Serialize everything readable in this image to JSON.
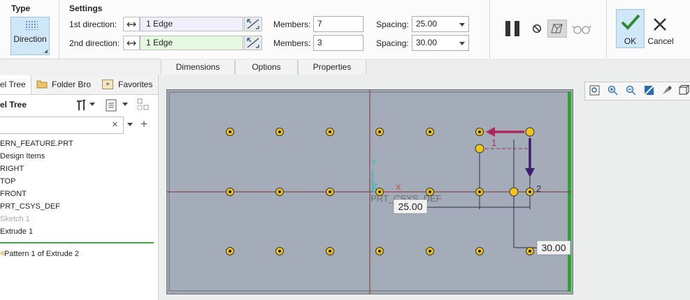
{
  "ribbon": {
    "type_group": {
      "title": "Type",
      "direction_label": "Direction"
    },
    "settings": {
      "title": "Settings",
      "first_direction_label": "1st direction:",
      "second_direction_label": "2nd direction:",
      "first_reference": "1 Edge",
      "second_reference": "1 Edge",
      "members_label": "Members:",
      "first_members": "7",
      "second_members": "3",
      "spacing_label": "Spacing:",
      "first_spacing": "25.00",
      "second_spacing": "30.00"
    },
    "ok_label": "OK",
    "cancel_label": "Cancel",
    "tabs": [
      "Dimensions",
      "Options",
      "Properties"
    ]
  },
  "left_panel": {
    "tabs": [
      "el Tree",
      "Folder Bro",
      "Favorites"
    ],
    "tree_header": "el Tree",
    "filter_value": "",
    "items": [
      {
        "label": "ERN_FEATURE.PRT",
        "dim": false
      },
      {
        "label": "Design Items",
        "dim": false
      },
      {
        "label": "RIGHT",
        "dim": false
      },
      {
        "label": "TOP",
        "dim": false
      },
      {
        "label": "FRONT",
        "dim": false
      },
      {
        "label": "PRT_CSYS_DEF",
        "dim": false
      },
      {
        "label": "Sketch 1",
        "dim": true
      },
      {
        "label": "Extrude 1",
        "dim": false
      }
    ],
    "pattern_item": "Pattern 1 of Extrude 2"
  },
  "graphics": {
    "csys_label": "PRT_CSYS_DEF",
    "axis_x": "X",
    "axis_y": "Y",
    "axis_z": "Z",
    "dim_spacing_1": "25.00",
    "dim_spacing_2": "30.00",
    "direction_1_label": "1",
    "direction_2_label": "2",
    "colors": {
      "background": "#a4acb9",
      "point": "#f0c419",
      "dir1": "#b0275a",
      "dir2": "#3c1e6e",
      "edge_green": "#1db31d"
    }
  }
}
